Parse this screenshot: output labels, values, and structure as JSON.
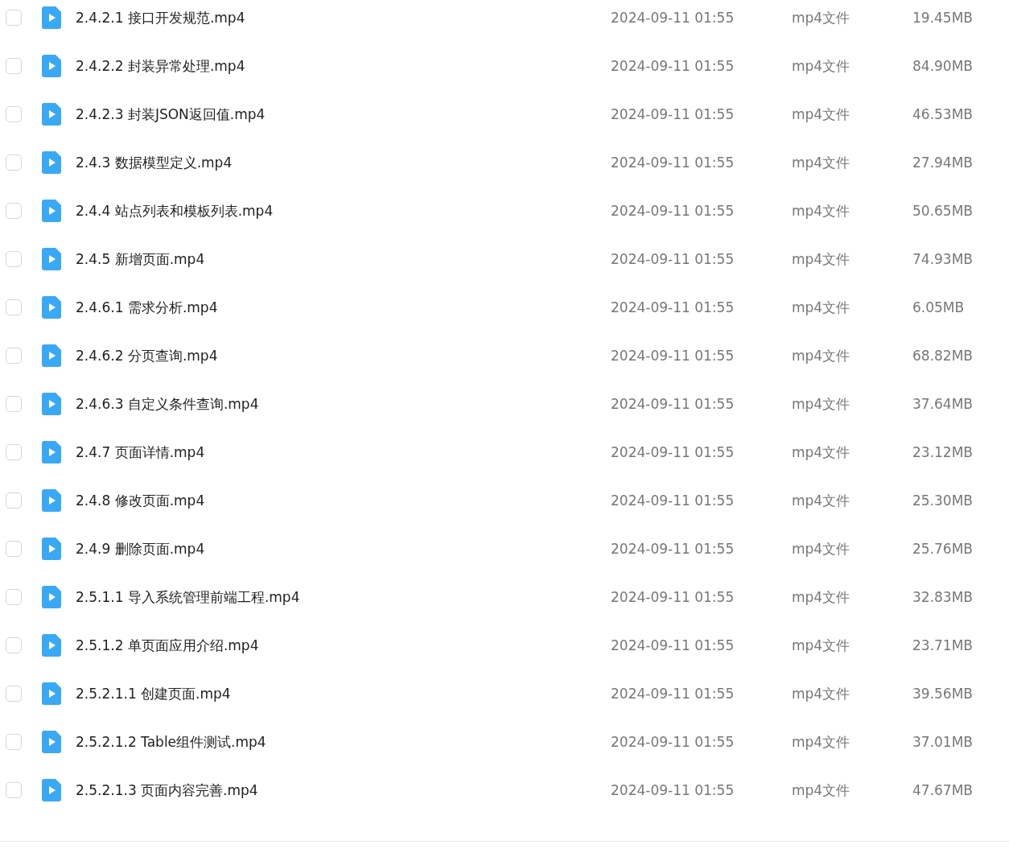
{
  "files": [
    {
      "name": "2.4.2.1 接口开发规范.mp4",
      "date": "2024-09-11 01:55",
      "type": "mp4文件",
      "size": "19.45MB",
      "checked": false
    },
    {
      "name": "2.4.2.2 封装异常处理.mp4",
      "date": "2024-09-11 01:55",
      "type": "mp4文件",
      "size": "84.90MB",
      "checked": false
    },
    {
      "name": "2.4.2.3 封装JSON返回值.mp4",
      "date": "2024-09-11 01:55",
      "type": "mp4文件",
      "size": "46.53MB",
      "checked": false
    },
    {
      "name": "2.4.3 数据模型定义.mp4",
      "date": "2024-09-11 01:55",
      "type": "mp4文件",
      "size": "27.94MB",
      "checked": false
    },
    {
      "name": "2.4.4 站点列表和模板列表.mp4",
      "date": "2024-09-11 01:55",
      "type": "mp4文件",
      "size": "50.65MB",
      "checked": false
    },
    {
      "name": "2.4.5 新增页面.mp4",
      "date": "2024-09-11 01:55",
      "type": "mp4文件",
      "size": "74.93MB",
      "checked": false
    },
    {
      "name": "2.4.6.1 需求分析.mp4",
      "date": "2024-09-11 01:55",
      "type": "mp4文件",
      "size": "6.05MB",
      "checked": false
    },
    {
      "name": "2.4.6.2 分页查询.mp4",
      "date": "2024-09-11 01:55",
      "type": "mp4文件",
      "size": "68.82MB",
      "checked": false
    },
    {
      "name": "2.4.6.3 自定义条件查询.mp4",
      "date": "2024-09-11 01:55",
      "type": "mp4文件",
      "size": "37.64MB",
      "checked": false
    },
    {
      "name": "2.4.7 页面详情.mp4",
      "date": "2024-09-11 01:55",
      "type": "mp4文件",
      "size": "23.12MB",
      "checked": false
    },
    {
      "name": "2.4.8 修改页面.mp4",
      "date": "2024-09-11 01:55",
      "type": "mp4文件",
      "size": "25.30MB",
      "checked": false
    },
    {
      "name": "2.4.9 删除页面.mp4",
      "date": "2024-09-11 01:55",
      "type": "mp4文件",
      "size": "25.76MB",
      "checked": false
    },
    {
      "name": "2.5.1.1 导入系统管理前端工程.mp4",
      "date": "2024-09-11 01:55",
      "type": "mp4文件",
      "size": "32.83MB",
      "checked": false
    },
    {
      "name": "2.5.1.2 单页面应用介绍.mp4",
      "date": "2024-09-11 01:55",
      "type": "mp4文件",
      "size": "23.71MB",
      "checked": false
    },
    {
      "name": "2.5.2.1.1 创建页面.mp4",
      "date": "2024-09-11 01:55",
      "type": "mp4文件",
      "size": "39.56MB",
      "checked": false
    },
    {
      "name": "2.5.2.1.2 Table组件测试.mp4",
      "date": "2024-09-11 01:55",
      "type": "mp4文件",
      "size": "37.01MB",
      "checked": false
    },
    {
      "name": "2.5.2.1.3 页面内容完善.mp4",
      "date": "2024-09-11 01:55",
      "type": "mp4文件",
      "size": "47.67MB",
      "checked": false
    }
  ]
}
